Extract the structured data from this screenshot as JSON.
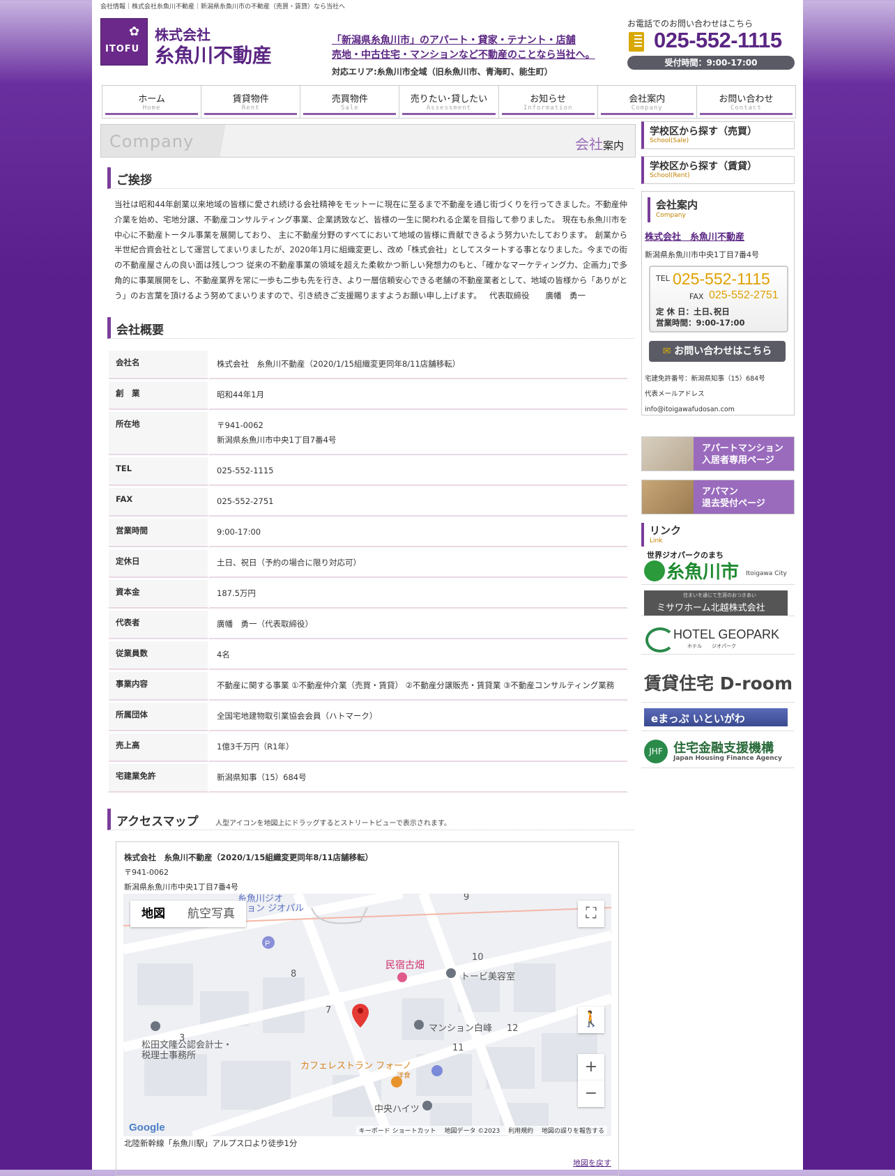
{
  "topline": "会社情報｜株式会社糸魚川不動産｜新潟県糸魚川市の不動産（売買・賃貸）なら当社へ",
  "logo": {
    "mark": "ITOFU",
    "line1": "株式会社",
    "line2": "糸魚川不動産"
  },
  "header": {
    "copy1": "「新潟県糸魚川市」のアパート・貸家・テナント・店舗",
    "copy2": "売地・中古住宅・マンションなど不動産のことなら当社へ。",
    "area": "対応エリア:糸魚川市全域（旧糸魚川市、青海町、能生町）",
    "tel_caption": "お電話でのお問い合わせはこちら",
    "tel": "025-552-1115",
    "hours": "受付時間：9:00-17:00"
  },
  "nav": [
    {
      "jp": "ホーム",
      "en": "Home"
    },
    {
      "jp": "賃貸物件",
      "en": "Rent"
    },
    {
      "jp": "売買物件",
      "en": "Sale"
    },
    {
      "jp": "売りたい･貸したい",
      "en": "Assessment"
    },
    {
      "jp": "お知らせ",
      "en": "Information"
    },
    {
      "jp": "会社案内",
      "en": "Company"
    },
    {
      "jp": "お問い合わせ",
      "en": "Contact"
    }
  ],
  "pagetitle": {
    "en": "Company",
    "jp_accent": "会社",
    "jp_rest": "案内"
  },
  "greeting": {
    "heading": "ご挨拶",
    "body": "当社は昭和44年創業以来地域の皆様に愛され続ける会社精神をモットーに現在に至るまで不動産を通じ街づくりを行ってきました。不動産仲介業を始め、宅地分譲、不動産コンサルティング事業、企業誘致など、皆様の一生に関われる企業を目指して参りました。 現在も糸魚川市を中心に不動産トータル事業を展開しており、 主に不動産分野のすべてにおいて地域の皆様に貢献できるよう努力いたしております。 創業から半世紀合資会社として運営してまいりましたが、2020年1月に組織変更し、改め「株式会社」としてスタートする事となりました。今までの街の不動産屋さんの良い面は残しつつ 従来の不動産事業の領域を超えた柔軟かつ新しい発想力のもと、｢確かなマーケティング力、企画力｣で多角的に事業展開をし、不動産業界を常に一歩も二歩も先を行き、より一層信頼安心できる老舗の不動産業者として、地域の皆様から「ありがとう」のお言葉を頂けるよう努めてまいりますので、引き続きご支援賜りますようお願い申し上げます。",
    "sign": "代表取締役　　廣幡　勇一"
  },
  "overview": {
    "heading": "会社概要",
    "rows": [
      {
        "k": "会社名",
        "v": "株式会社　糸魚川不動産（2020/1/15組織変更同年8/11店舗移転）"
      },
      {
        "k": "創　業",
        "v": "昭和44年1月"
      },
      {
        "k": "所在地",
        "v": "〒941-0062",
        "v2": "新潟県糸魚川市中央1丁目7番4号"
      },
      {
        "k": "TEL",
        "v": "025-552-1115"
      },
      {
        "k": "FAX",
        "v": "025-552-2751"
      },
      {
        "k": "営業時間",
        "v": "9:00-17:00"
      },
      {
        "k": "定休日",
        "v": "土日、祝日（予約の場合に限り対応可）"
      },
      {
        "k": "資本金",
        "v": "187.5万円"
      },
      {
        "k": "代表者",
        "v": "廣幡　勇一（代表取締役）"
      },
      {
        "k": "従業員数",
        "v": "4名"
      },
      {
        "k": "事業内容",
        "v": "不動産に関する事業 ①不動産仲介業（売買・賃貸） ②不動産分譲販売・賃貸業 ③不動産コンサルティング業務"
      },
      {
        "k": "所属団体",
        "v": "全国宅地建物取引業協会会員（ハトマーク）"
      },
      {
        "k": "売上高",
        "v": "1億3千万円（R1年）"
      },
      {
        "k": "宅建業免許",
        "v": "新潟県知事（15）684号"
      }
    ]
  },
  "access": {
    "heading": "アクセスマップ",
    "note": "人型アイコンを地図上にドラッグするとストリートビューで表示されます。",
    "name": "株式会社　糸魚川不動産（2020/1/15組織変更同年8/11店舗移転）",
    "zip": "〒941-0062",
    "address": "新潟県糸魚川市中央1丁目7番4号",
    "map_tab_map": "地図",
    "map_tab_sat": "航空写真",
    "map_labels": [
      "糸魚川ジオ",
      "ション ジオパル",
      "民宿古畑",
      "トービ美容室",
      "マンション白峰",
      "松田文隆公認会計士・",
      "税理士事務所",
      "カフェレストラン フォーノ",
      "洋食",
      "中央ハイツ",
      "10",
      "8",
      "7",
      "12",
      "11",
      "3",
      "9"
    ],
    "map_footer": "キーボード ショートカット　 地図データ ©2023　 利用規約　 地図の誤りを報告する",
    "google": "Google",
    "station": "北陸新幹線「糸魚川駅」アルプス口より徒歩1分",
    "back": "地図を戻す"
  },
  "side": {
    "school_sale": {
      "t": "学校区から探す（売買）",
      "s": "School(Sale)"
    },
    "school_rent": {
      "t": "学校区から探す（賃貸）",
      "s": "School(Rent)"
    },
    "company": {
      "t": "会社案内",
      "s": "Company",
      "name": "株式会社　糸魚川不動産",
      "addr": "新潟県糸魚川市中央1丁目7番4号",
      "tel_label": "TEL",
      "tel": "025-552-1115",
      "fax_label": "FAX",
      "fax": "025-552-2751",
      "holiday": "定 休 日：土日､祝日",
      "hours": "営業時間：9:00-17:00",
      "contact": "お問い合わせはこちら",
      "license": "宅建免許番号：新潟県知事（15）684号",
      "mail_label": "代表メールアドレス",
      "mail": "info@itoigawafudosan.com"
    },
    "banner1": {
      "l1": "アパートマンション",
      "l2": "入居者専用ページ"
    },
    "banner2": {
      "l1": "アパマン",
      "l2": "退去受付ページ"
    },
    "links": {
      "t": "リンク",
      "s": "Link"
    },
    "link_items": {
      "city_sub": "世界ジオパークのまち",
      "city": "糸魚川市",
      "city_en": "Itoigawa City",
      "misawa_sub": "住まいを通じて生涯のおつきあい",
      "misawa": "ミサワホーム北越株式会社",
      "hotel": "HOTEL GEOPARK",
      "hotel_sub": "ホテル　　ジオパーク",
      "droom": "賃貸住宅 D-room",
      "emap": "eまっぷ いといがわ",
      "jhf": "住宅金融支援機構",
      "jhf_en": "Japan Housing Finance Agency"
    }
  }
}
